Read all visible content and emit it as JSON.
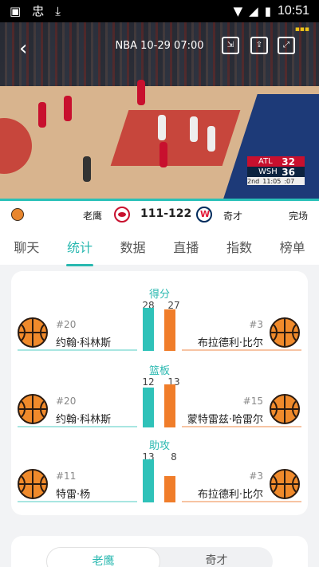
{
  "status_bar": {
    "time": "10:51",
    "icons": [
      "image-icon",
      "app-icon",
      "download-icon",
      "wifi-icon",
      "signal-icon",
      "battery-icon"
    ]
  },
  "video": {
    "title": "NBA  10-29 07:00",
    "scorebug": {
      "team1": "ATL",
      "team1_score": "32",
      "team2": "WSH",
      "team2_score": "36",
      "quarter": "2nd",
      "clock": "11:05",
      "shot_clock": ":07"
    }
  },
  "match": {
    "home_team": "老鹰",
    "score": "111-122",
    "away_team": "奇才",
    "status": "完场"
  },
  "tabs": [
    "聊天",
    "统计",
    "数据",
    "直播",
    "指数",
    "榜单"
  ],
  "active_tab": 1,
  "stats": [
    {
      "category": "得分",
      "left": {
        "value": 28,
        "number": "#20",
        "name": "约翰·科林斯"
      },
      "right": {
        "value": 27,
        "number": "#3",
        "name": "布拉德利·比尔"
      }
    },
    {
      "category": "篮板",
      "left": {
        "value": 12,
        "number": "#20",
        "name": "约翰·科林斯"
      },
      "right": {
        "value": 13,
        "number": "#15",
        "name": "蒙特雷兹·哈雷尔"
      }
    },
    {
      "category": "助攻",
      "left": {
        "value": 13,
        "number": "#11",
        "name": "特雷·杨"
      },
      "right": {
        "value": 8,
        "number": "#3",
        "name": "布拉德利·比尔"
      }
    }
  ],
  "team_toggle": [
    "老鹰",
    "奇才"
  ],
  "colors": {
    "accent": "#29b8b0",
    "home_bar": "#2fc2b9",
    "away_bar": "#f07d2a"
  }
}
